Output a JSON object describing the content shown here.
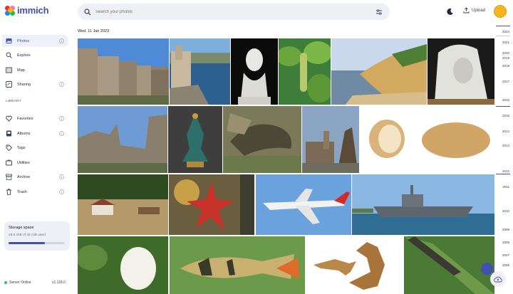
{
  "app": {
    "name": "immich"
  },
  "search": {
    "placeholder": "Search your photos"
  },
  "header": {
    "upload_label": "Upload"
  },
  "sidebar": {
    "items": [
      {
        "label": "Photos",
        "icon": "image-icon",
        "active": true,
        "info": true
      },
      {
        "label": "Explore",
        "icon": "explore-icon",
        "active": false,
        "info": false
      },
      {
        "label": "Map",
        "icon": "map-icon",
        "active": false,
        "info": false
      },
      {
        "label": "Sharing",
        "icon": "sharing-icon",
        "active": false,
        "info": true
      }
    ],
    "library_label": "LIBRARY",
    "library_items": [
      {
        "label": "Favorites",
        "icon": "heart-icon",
        "info": true
      },
      {
        "label": "Albums",
        "icon": "album-icon",
        "info": true
      },
      {
        "label": "Tags",
        "icon": "tag-icon",
        "info": false
      },
      {
        "label": "Utilities",
        "icon": "utilities-icon",
        "info": false
      },
      {
        "label": "Archive",
        "icon": "archive-icon",
        "info": true
      },
      {
        "label": "Trash",
        "icon": "trash-icon",
        "info": true
      }
    ]
  },
  "storage": {
    "title": "Storage space",
    "used": "28.6 GiB of 45 GiB used",
    "fraction": 0.64
  },
  "server": {
    "status": "Server Online",
    "version": "v1.118.0"
  },
  "timeline": {
    "date_heading": "Wed, 11 Jan 2023",
    "years": [
      "2024",
      "2021",
      "2020",
      "2019",
      "2018",
      "2017",
      "2016",
      "2015",
      "2014",
      "2013",
      "2012",
      "2011",
      "2010",
      "2009",
      "2008",
      "2007",
      "2006"
    ]
  },
  "colors": {
    "accent": "#4250af",
    "avatar": "#f6b51e"
  }
}
